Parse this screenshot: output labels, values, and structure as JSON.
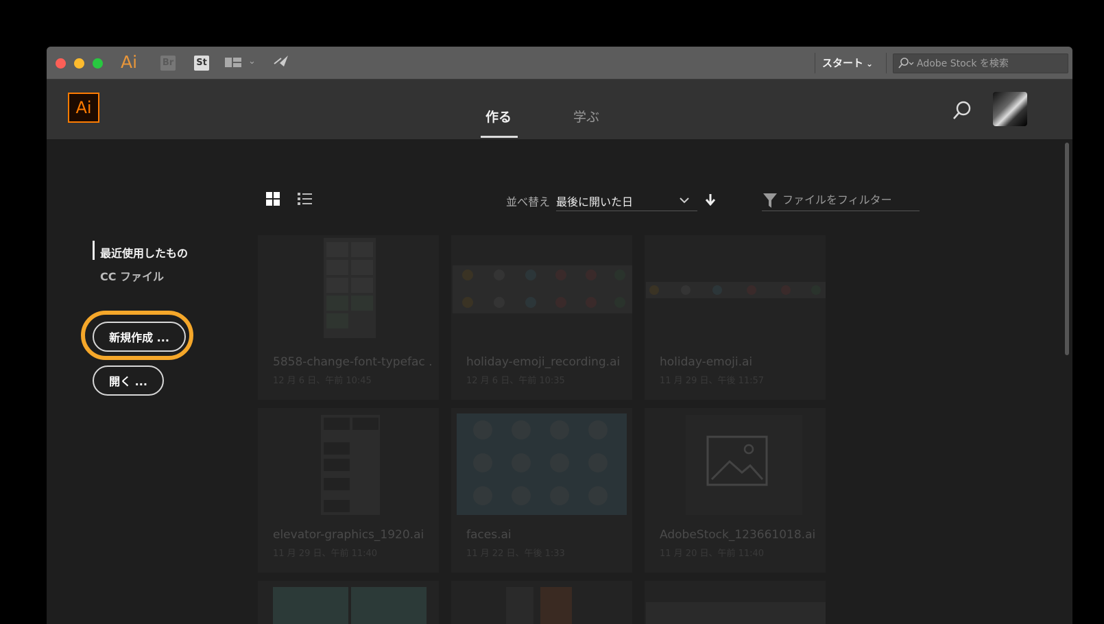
{
  "titlebar": {
    "app_icon_text": "Ai",
    "bridge_label": "Br",
    "stock_label": "St",
    "workspace_label": "スタート",
    "stock_search_placeholder": "Adobe Stock を検索"
  },
  "header": {
    "logo_text": "Ai",
    "tabs": [
      {
        "label": "作る",
        "active": true
      },
      {
        "label": "学ぶ",
        "active": false
      }
    ]
  },
  "toolbar": {
    "sort_label": "並べ替え",
    "sort_value": "最後に開いた日",
    "filter_placeholder": "ファイルをフィルター"
  },
  "sidebar": {
    "items": [
      {
        "label": "最近使用したもの",
        "active": true
      },
      {
        "label": "CC ファイル",
        "active": false
      }
    ],
    "new_button": "新規作成 ...",
    "open_button": "開く ..."
  },
  "files": [
    {
      "name": "5858-change-font-typefac ...",
      "date": "12 月 6 日、午前 10:45"
    },
    {
      "name": "holiday-emoji_recording.ai",
      "date": "12 月 6 日、午前 10:35"
    },
    {
      "name": "holiday-emoji.ai",
      "date": "11 月 29 日、午後 11:57"
    },
    {
      "name": "elevator-graphics_1920.ai",
      "date": "11 月 29 日、午前 11:40"
    },
    {
      "name": "faces.ai",
      "date": "11 月 22 日、午後 1:33"
    },
    {
      "name": "AdobeStock_123661018.ai",
      "date": "11 月 20 日、午前 11:40"
    }
  ],
  "colors": {
    "highlight": "#f5a72a",
    "ai_orange": "#ff7c00"
  }
}
